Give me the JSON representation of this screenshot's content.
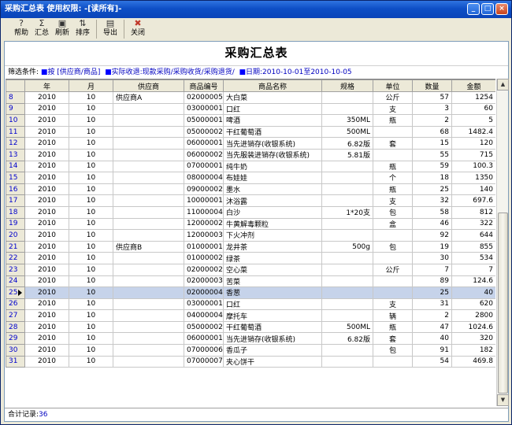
{
  "window": {
    "title": "采购汇总表  使用权限: -[读所有]-"
  },
  "toolbar": {
    "help": "帮助",
    "summary": "汇总",
    "refresh": "刷新",
    "sort": "排序",
    "export": "导出",
    "close": "关闭"
  },
  "report": {
    "title": "采购汇总表"
  },
  "filter": {
    "label": "筛选条件:",
    "by": "按 [供应商/商品]",
    "source": "实际收退:现款采购/采购收货/采购退货/",
    "date": "日期:2010-10-01至2010-10-05"
  },
  "columns": [
    "年",
    "月",
    "供应商",
    "商品编号",
    "商品名称",
    "规格",
    "单位",
    "数量",
    "金额"
  ],
  "rows": [
    {
      "n": "8",
      "year": "2010",
      "month": "10",
      "supplier": "供应商A",
      "code": "02000005",
      "name": "大白菜",
      "spec": "",
      "unit": "公斤",
      "qty": "57",
      "amount": "1254"
    },
    {
      "n": "9",
      "year": "2010",
      "month": "10",
      "supplier": "",
      "code": "03000001",
      "name": "口红",
      "spec": "",
      "unit": "支",
      "qty": "3",
      "amount": "60"
    },
    {
      "n": "10",
      "year": "2010",
      "month": "10",
      "supplier": "",
      "code": "05000001",
      "name": "啤酒",
      "spec": "350ML",
      "unit": "瓶",
      "qty": "2",
      "amount": "5"
    },
    {
      "n": "11",
      "year": "2010",
      "month": "10",
      "supplier": "",
      "code": "05000002",
      "name": "干红葡萄酒",
      "spec": "500ML",
      "unit": "",
      "qty": "68",
      "amount": "1482.4"
    },
    {
      "n": "12",
      "year": "2010",
      "month": "10",
      "supplier": "",
      "code": "06000001",
      "name": "当先进销存(收银系统)",
      "spec": "6.82版",
      "unit": "套",
      "qty": "15",
      "amount": "120"
    },
    {
      "n": "13",
      "year": "2010",
      "month": "10",
      "supplier": "",
      "code": "06000002",
      "name": "当先服装进销存(收银系统)",
      "spec": "5.81版",
      "unit": "",
      "qty": "55",
      "amount": "715"
    },
    {
      "n": "14",
      "year": "2010",
      "month": "10",
      "supplier": "",
      "code": "07000001",
      "name": "纯牛奶",
      "spec": "",
      "unit": "瓶",
      "qty": "59",
      "amount": "100.3"
    },
    {
      "n": "15",
      "year": "2010",
      "month": "10",
      "supplier": "",
      "code": "08000004",
      "name": "布娃娃",
      "spec": "",
      "unit": "个",
      "qty": "18",
      "amount": "1350"
    },
    {
      "n": "16",
      "year": "2010",
      "month": "10",
      "supplier": "",
      "code": "09000002",
      "name": "墨水",
      "spec": "",
      "unit": "瓶",
      "qty": "25",
      "amount": "140"
    },
    {
      "n": "17",
      "year": "2010",
      "month": "10",
      "supplier": "",
      "code": "10000001",
      "name": "沐浴露",
      "spec": "",
      "unit": "支",
      "qty": "32",
      "amount": "697.6"
    },
    {
      "n": "18",
      "year": "2010",
      "month": "10",
      "supplier": "",
      "code": "11000004",
      "name": "白沙",
      "spec": "1*20支",
      "unit": "包",
      "qty": "58",
      "amount": "812"
    },
    {
      "n": "19",
      "year": "2010",
      "month": "10",
      "supplier": "",
      "code": "12000002",
      "name": "牛黄解毒颗粒",
      "spec": "",
      "unit": "盒",
      "qty": "46",
      "amount": "322"
    },
    {
      "n": "20",
      "year": "2010",
      "month": "10",
      "supplier": "",
      "code": "12000003",
      "name": "下火冲剂",
      "spec": "",
      "unit": "",
      "qty": "92",
      "amount": "644"
    },
    {
      "n": "21",
      "year": "2010",
      "month": "10",
      "supplier": "供应商B",
      "code": "01000001",
      "name": "龙井茶",
      "spec": "500g",
      "unit": "包",
      "qty": "19",
      "amount": "855"
    },
    {
      "n": "22",
      "year": "2010",
      "month": "10",
      "supplier": "",
      "code": "01000002",
      "name": "绿茶",
      "spec": "",
      "unit": "",
      "qty": "30",
      "amount": "534"
    },
    {
      "n": "23",
      "year": "2010",
      "month": "10",
      "supplier": "",
      "code": "02000002",
      "name": "空心菜",
      "spec": "",
      "unit": "公斤",
      "qty": "7",
      "amount": "7"
    },
    {
      "n": "24",
      "year": "2010",
      "month": "10",
      "supplier": "",
      "code": "02000003",
      "name": "苦菜",
      "spec": "",
      "unit": "",
      "qty": "89",
      "amount": "124.6"
    },
    {
      "n": "25",
      "year": "2010",
      "month": "10",
      "supplier": "",
      "code": "02000004",
      "name": "香葱",
      "spec": "",
      "unit": "",
      "qty": "25",
      "amount": "40",
      "selected": true
    },
    {
      "n": "26",
      "year": "2010",
      "month": "10",
      "supplier": "",
      "code": "03000001",
      "name": "口红",
      "spec": "",
      "unit": "支",
      "qty": "31",
      "amount": "620"
    },
    {
      "n": "27",
      "year": "2010",
      "month": "10",
      "supplier": "",
      "code": "04000004",
      "name": "摩托车",
      "spec": "",
      "unit": "辆",
      "qty": "2",
      "amount": "2800"
    },
    {
      "n": "28",
      "year": "2010",
      "month": "10",
      "supplier": "",
      "code": "05000002",
      "name": "干红葡萄酒",
      "spec": "500ML",
      "unit": "瓶",
      "qty": "47",
      "amount": "1024.6"
    },
    {
      "n": "29",
      "year": "2010",
      "month": "10",
      "supplier": "",
      "code": "06000001",
      "name": "当先进销存(收银系统)",
      "spec": "6.82版",
      "unit": "套",
      "qty": "40",
      "amount": "320"
    },
    {
      "n": "30",
      "year": "2010",
      "month": "10",
      "supplier": "",
      "code": "07000006",
      "name": "香瓜子",
      "spec": "",
      "unit": "包",
      "qty": "91",
      "amount": "182"
    },
    {
      "n": "31",
      "year": "2010",
      "month": "10",
      "supplier": "",
      "code": "07000007",
      "name": "夹心饼干",
      "spec": "",
      "unit": "",
      "qty": "54",
      "amount": "469.8"
    }
  ],
  "status": {
    "label": "合计记录:",
    "count": "36"
  }
}
